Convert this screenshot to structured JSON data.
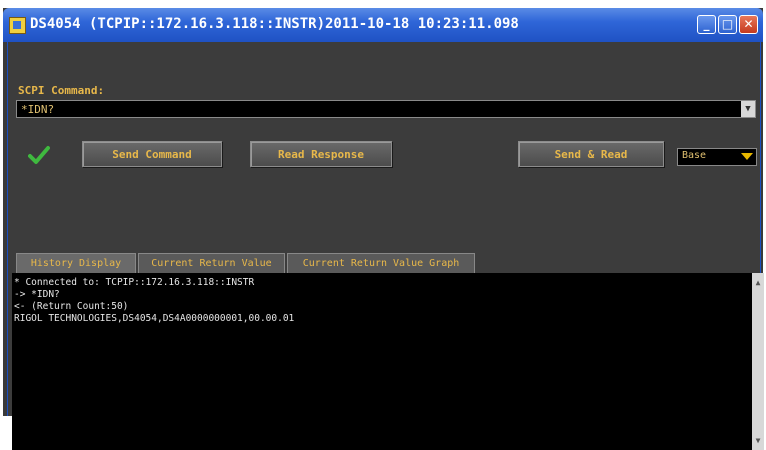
{
  "window": {
    "title": "DS4054 (TCPIP::172.16.3.118::INSTR)2011-10-18 10:23:11.098",
    "icon": "app-icon",
    "controls": {
      "minimize_icon": "minimize-icon",
      "maximize_icon": "maximize-icon",
      "close_icon": "close-icon"
    }
  },
  "command": {
    "label": "SCPI Command:",
    "value": "*IDN?"
  },
  "status": {
    "icon": "green-checkmark-icon",
    "color": "#3fb93f"
  },
  "buttons": {
    "send": "Send Command",
    "read": "Read Response",
    "send_read": "Send & Read"
  },
  "format": {
    "selected": "Base"
  },
  "tabs": [
    {
      "label": "History Display",
      "active": true
    },
    {
      "label": "Current Return Value",
      "active": false
    },
    {
      "label": "Current Return Value Graph",
      "active": false
    }
  ],
  "history": [
    "* Connected to: TCPIP::172.16.3.118::INSTR",
    "-> *IDN?",
    "<- (Return Count:50)",
    "RIGOL TECHNOLOGIES,DS4054,DS4A0000000001,00.00.01"
  ],
  "colors": {
    "accent_text": "#e8b84a",
    "titlebar": "#2f66d8",
    "background": "#3c3c3c"
  }
}
